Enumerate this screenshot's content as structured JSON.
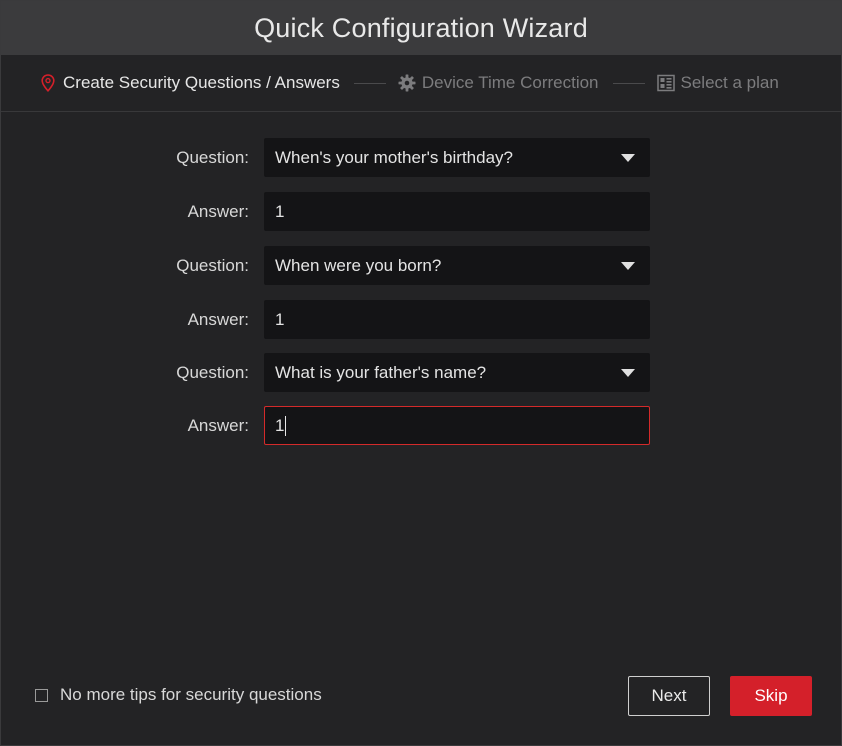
{
  "window": {
    "title": "Quick Configuration Wizard"
  },
  "steps": [
    {
      "label": "Create Security Questions / Answers",
      "icon": "location-pin-icon",
      "state": "active"
    },
    {
      "label": "Device Time Correction",
      "icon": "gear-icon",
      "state": "inactive"
    },
    {
      "label": "Select a plan",
      "icon": "plan-grid-icon",
      "state": "inactive"
    }
  ],
  "form": {
    "question_label": "Question:",
    "answer_label": "Answer:",
    "pairs": [
      {
        "question": "When's your mother's birthday?",
        "answer": "1"
      },
      {
        "question": "When were you born?",
        "answer": "1"
      },
      {
        "question": "What is your father's name?",
        "answer": "1"
      }
    ]
  },
  "footer": {
    "no_more_tips_label": "No more tips for security questions",
    "no_more_tips_checked": false,
    "next_label": "Next",
    "skip_label": "Skip"
  },
  "colors": {
    "accent": "#d4202a",
    "background": "#232325",
    "titlebar": "#3b3b3d",
    "field_background": "#141416"
  }
}
